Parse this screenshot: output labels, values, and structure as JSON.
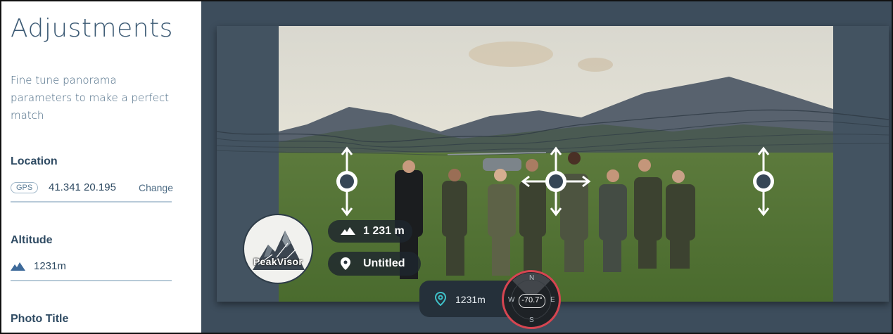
{
  "sidebar": {
    "title": "Adjustments",
    "description": "Fine tune panorama parameters to make a perfect match",
    "location": {
      "label": "Location",
      "badge": "GPS",
      "value": "41.341 20.195",
      "change_label": "Change"
    },
    "altitude": {
      "label": "Altitude",
      "value": "1231m",
      "icon": "mountain-icon"
    },
    "photo_title": {
      "label": "Photo Title"
    }
  },
  "viewer": {
    "altitude_pill": "1 231 m",
    "title_pill": "Untitled",
    "logo_text": "PeakVisor",
    "bottom_altitude": "1231m",
    "compass": {
      "heading": "-70.7°",
      "north": "N",
      "east": "E",
      "south": "S",
      "west": "W"
    }
  },
  "colors": {
    "panel_background": "#3d4d5c",
    "sidebar_text": "#2e4a62",
    "compass_ring": "#d64551"
  }
}
